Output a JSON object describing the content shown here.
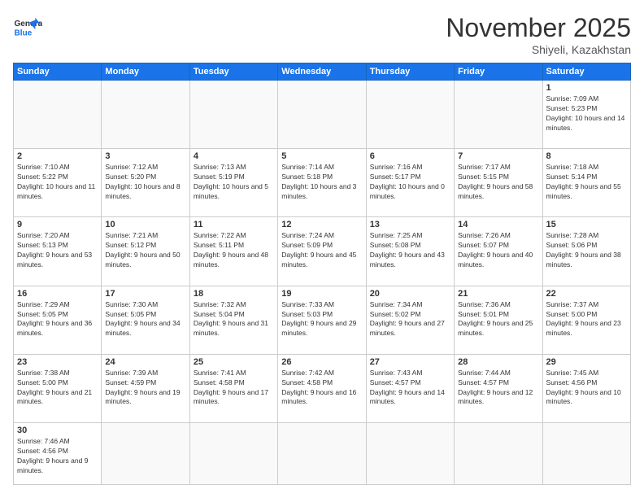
{
  "header": {
    "logo_general": "General",
    "logo_blue": "Blue",
    "month_title": "November 2025",
    "subtitle": "Shiyeli, Kazakhstan"
  },
  "days_of_week": [
    "Sunday",
    "Monday",
    "Tuesday",
    "Wednesday",
    "Thursday",
    "Friday",
    "Saturday"
  ],
  "weeks": [
    [
      {
        "day": "",
        "info": ""
      },
      {
        "day": "",
        "info": ""
      },
      {
        "day": "",
        "info": ""
      },
      {
        "day": "",
        "info": ""
      },
      {
        "day": "",
        "info": ""
      },
      {
        "day": "",
        "info": ""
      },
      {
        "day": "1",
        "info": "Sunrise: 7:09 AM\nSunset: 5:23 PM\nDaylight: 10 hours and 14 minutes."
      }
    ],
    [
      {
        "day": "2",
        "info": "Sunrise: 7:10 AM\nSunset: 5:22 PM\nDaylight: 10 hours and 11 minutes."
      },
      {
        "day": "3",
        "info": "Sunrise: 7:12 AM\nSunset: 5:20 PM\nDaylight: 10 hours and 8 minutes."
      },
      {
        "day": "4",
        "info": "Sunrise: 7:13 AM\nSunset: 5:19 PM\nDaylight: 10 hours and 5 minutes."
      },
      {
        "day": "5",
        "info": "Sunrise: 7:14 AM\nSunset: 5:18 PM\nDaylight: 10 hours and 3 minutes."
      },
      {
        "day": "6",
        "info": "Sunrise: 7:16 AM\nSunset: 5:17 PM\nDaylight: 10 hours and 0 minutes."
      },
      {
        "day": "7",
        "info": "Sunrise: 7:17 AM\nSunset: 5:15 PM\nDaylight: 9 hours and 58 minutes."
      },
      {
        "day": "8",
        "info": "Sunrise: 7:18 AM\nSunset: 5:14 PM\nDaylight: 9 hours and 55 minutes."
      }
    ],
    [
      {
        "day": "9",
        "info": "Sunrise: 7:20 AM\nSunset: 5:13 PM\nDaylight: 9 hours and 53 minutes."
      },
      {
        "day": "10",
        "info": "Sunrise: 7:21 AM\nSunset: 5:12 PM\nDaylight: 9 hours and 50 minutes."
      },
      {
        "day": "11",
        "info": "Sunrise: 7:22 AM\nSunset: 5:11 PM\nDaylight: 9 hours and 48 minutes."
      },
      {
        "day": "12",
        "info": "Sunrise: 7:24 AM\nSunset: 5:09 PM\nDaylight: 9 hours and 45 minutes."
      },
      {
        "day": "13",
        "info": "Sunrise: 7:25 AM\nSunset: 5:08 PM\nDaylight: 9 hours and 43 minutes."
      },
      {
        "day": "14",
        "info": "Sunrise: 7:26 AM\nSunset: 5:07 PM\nDaylight: 9 hours and 40 minutes."
      },
      {
        "day": "15",
        "info": "Sunrise: 7:28 AM\nSunset: 5:06 PM\nDaylight: 9 hours and 38 minutes."
      }
    ],
    [
      {
        "day": "16",
        "info": "Sunrise: 7:29 AM\nSunset: 5:05 PM\nDaylight: 9 hours and 36 minutes."
      },
      {
        "day": "17",
        "info": "Sunrise: 7:30 AM\nSunset: 5:05 PM\nDaylight: 9 hours and 34 minutes."
      },
      {
        "day": "18",
        "info": "Sunrise: 7:32 AM\nSunset: 5:04 PM\nDaylight: 9 hours and 31 minutes."
      },
      {
        "day": "19",
        "info": "Sunrise: 7:33 AM\nSunset: 5:03 PM\nDaylight: 9 hours and 29 minutes."
      },
      {
        "day": "20",
        "info": "Sunrise: 7:34 AM\nSunset: 5:02 PM\nDaylight: 9 hours and 27 minutes."
      },
      {
        "day": "21",
        "info": "Sunrise: 7:36 AM\nSunset: 5:01 PM\nDaylight: 9 hours and 25 minutes."
      },
      {
        "day": "22",
        "info": "Sunrise: 7:37 AM\nSunset: 5:00 PM\nDaylight: 9 hours and 23 minutes."
      }
    ],
    [
      {
        "day": "23",
        "info": "Sunrise: 7:38 AM\nSunset: 5:00 PM\nDaylight: 9 hours and 21 minutes."
      },
      {
        "day": "24",
        "info": "Sunrise: 7:39 AM\nSunset: 4:59 PM\nDaylight: 9 hours and 19 minutes."
      },
      {
        "day": "25",
        "info": "Sunrise: 7:41 AM\nSunset: 4:58 PM\nDaylight: 9 hours and 17 minutes."
      },
      {
        "day": "26",
        "info": "Sunrise: 7:42 AM\nSunset: 4:58 PM\nDaylight: 9 hours and 16 minutes."
      },
      {
        "day": "27",
        "info": "Sunrise: 7:43 AM\nSunset: 4:57 PM\nDaylight: 9 hours and 14 minutes."
      },
      {
        "day": "28",
        "info": "Sunrise: 7:44 AM\nSunset: 4:57 PM\nDaylight: 9 hours and 12 minutes."
      },
      {
        "day": "29",
        "info": "Sunrise: 7:45 AM\nSunset: 4:56 PM\nDaylight: 9 hours and 10 minutes."
      }
    ],
    [
      {
        "day": "30",
        "info": "Sunrise: 7:46 AM\nSunset: 4:56 PM\nDaylight: 9 hours and 9 minutes."
      },
      {
        "day": "",
        "info": ""
      },
      {
        "day": "",
        "info": ""
      },
      {
        "day": "",
        "info": ""
      },
      {
        "day": "",
        "info": ""
      },
      {
        "day": "",
        "info": ""
      },
      {
        "day": "",
        "info": ""
      }
    ]
  ]
}
